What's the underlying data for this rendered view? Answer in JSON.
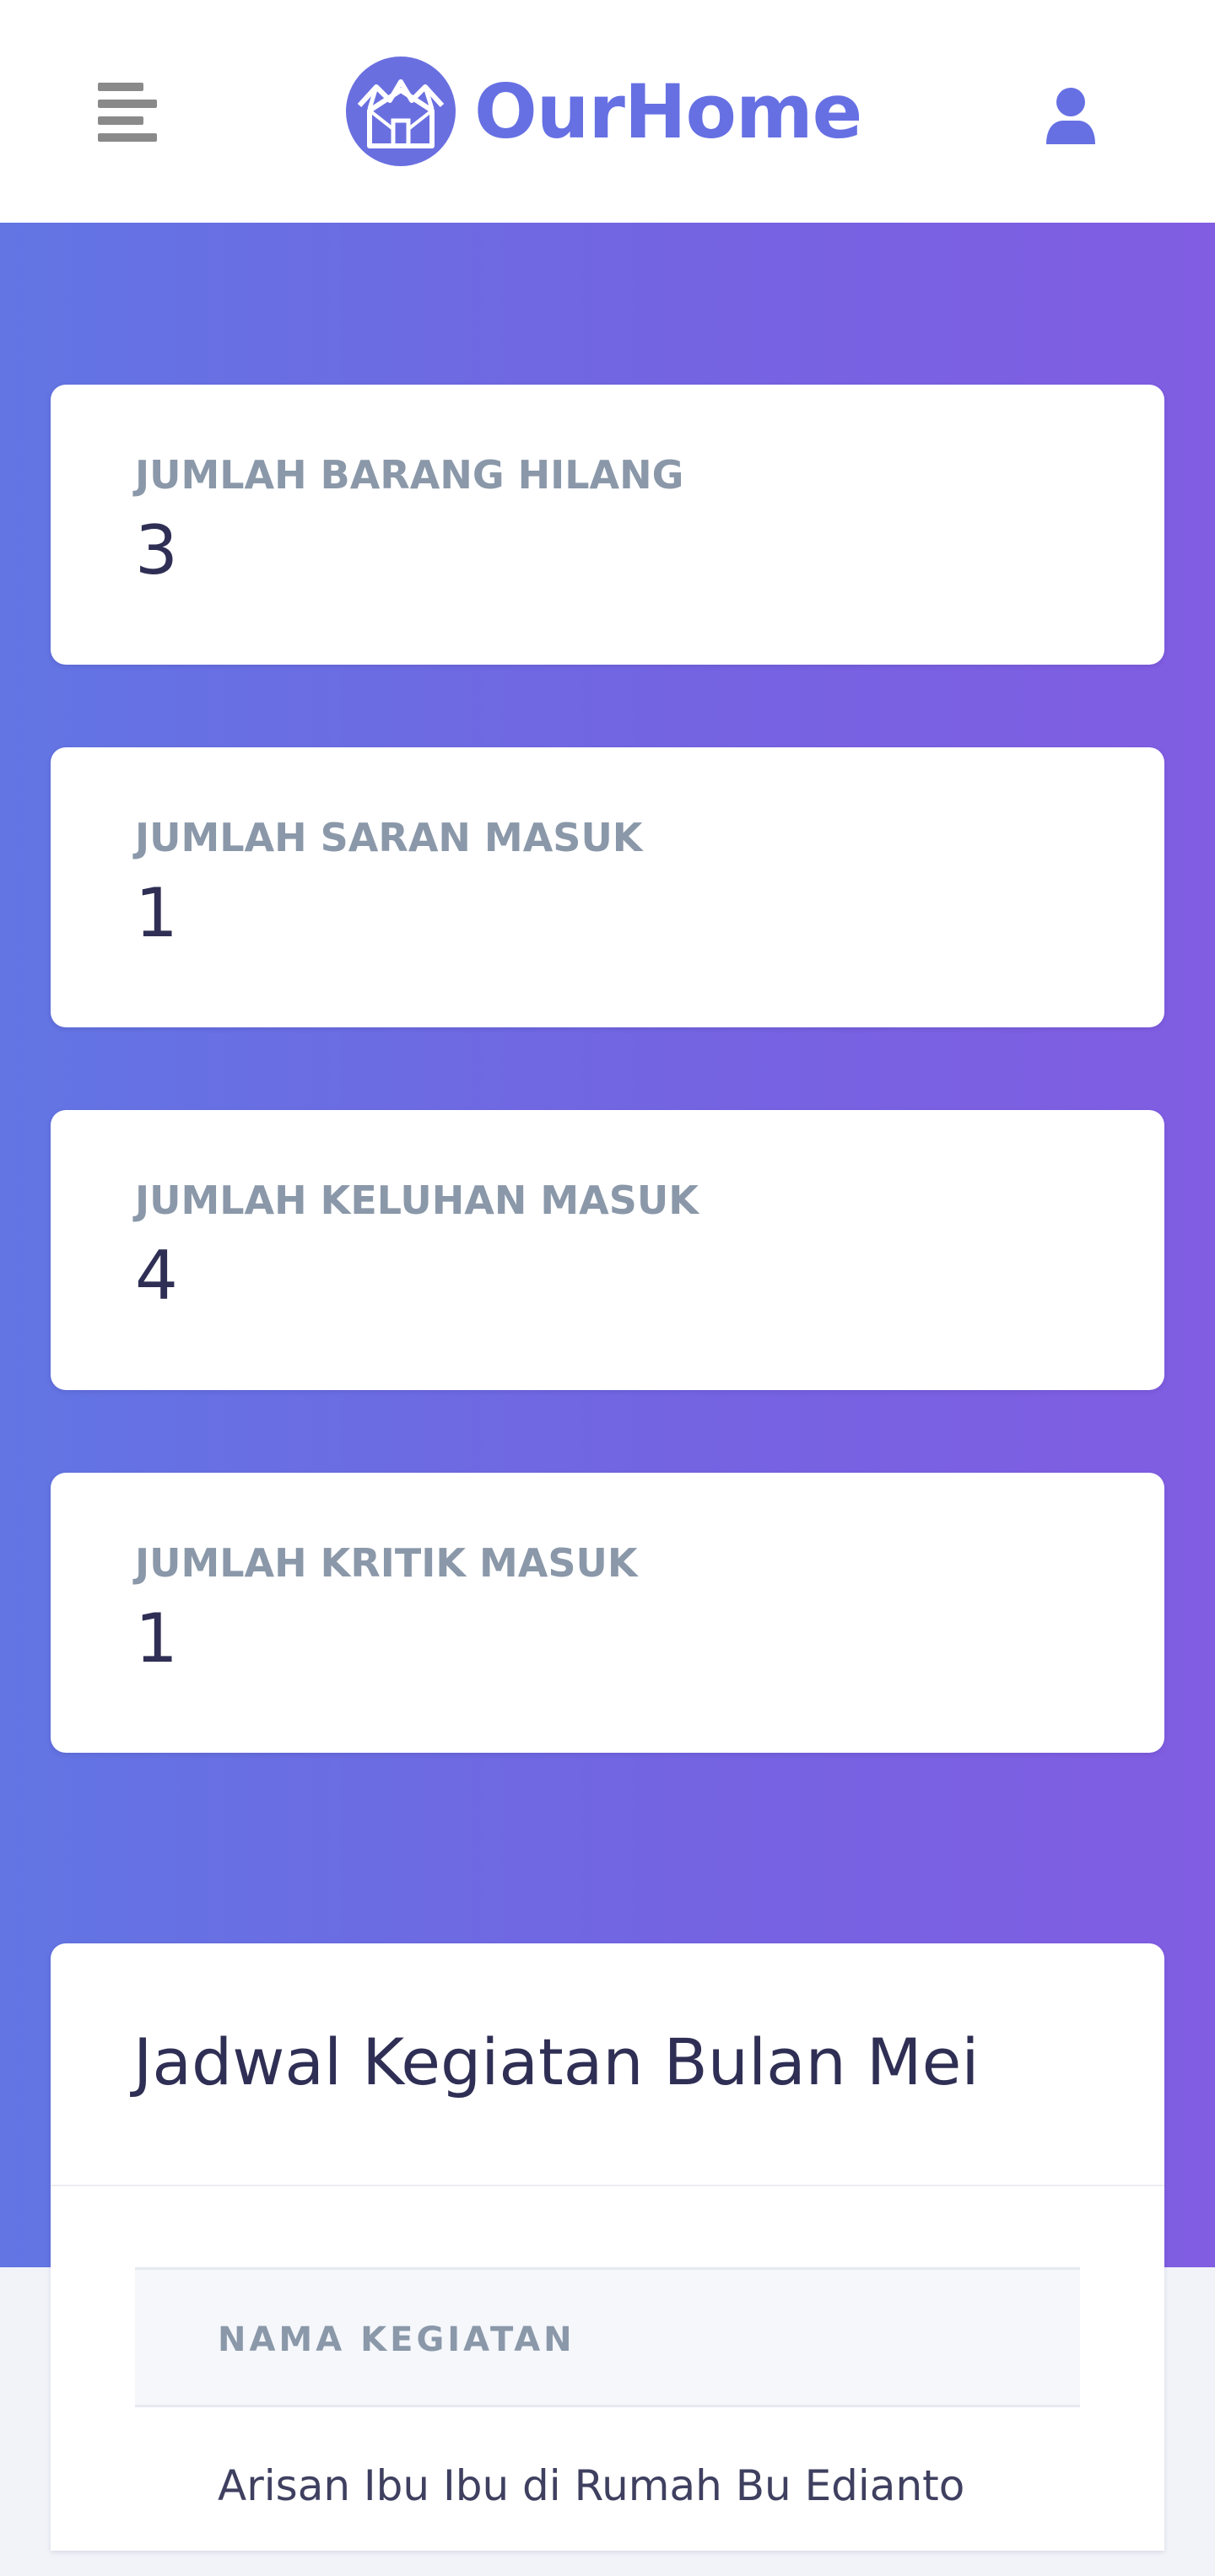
{
  "header": {
    "brand_name": "OurHome",
    "icons": {
      "menu": "menu-lines-icon",
      "logo": "house-network-icon",
      "user": "user-icon"
    },
    "brand_color": "#6670e3"
  },
  "stats": [
    {
      "label": "JUMLAH BARANG HILANG",
      "value": "3"
    },
    {
      "label": "JUMLAH SARAN MASUK",
      "value": "1"
    },
    {
      "label": "JUMLAH KELUHAN MASUK",
      "value": "4"
    },
    {
      "label": "JUMLAH KRITIK MASUK",
      "value": "1"
    }
  ],
  "schedule": {
    "title": "Jadwal Kegiatan Bulan Mei",
    "columns": [
      "NAMA KEGIATAN"
    ],
    "rows": [
      {
        "nama_kegiatan": "Arisan Ibu Ibu di Rumah Bu Edianto"
      }
    ]
  },
  "colors": {
    "hero_gradient_start": "#6275e3",
    "hero_gradient_end": "#815de2",
    "stat_label": "#8a98a9",
    "stat_value": "#2f2f55"
  }
}
